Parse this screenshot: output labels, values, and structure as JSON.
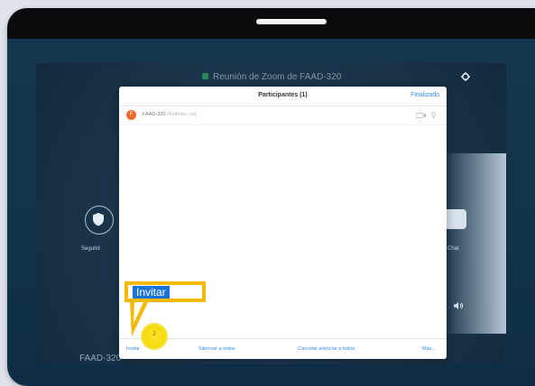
{
  "meeting": {
    "title": "Reunión de Zoom de FAAD-320",
    "room_name": "FAAD-320"
  },
  "side_controls": {
    "left_label": "Segurid",
    "right_label": "Chat"
  },
  "participants_panel": {
    "title": "Participantes (1)",
    "done_label": "Finalizado",
    "participants": [
      {
        "initial": "F",
        "name": "FAAD-320",
        "note": "(Anfitrión, yo)"
      }
    ],
    "footer": {
      "invite": "Invitar",
      "mute_all": "Silenciar a todos",
      "unmute_all": "Cancelar silenciar a todos",
      "more": "Más..."
    }
  },
  "callout": {
    "label": "Invitar",
    "step": "2"
  },
  "colors": {
    "accent_blue": "#2f8cf0",
    "callout_yellow": "#f5b900",
    "callout_label_bg": "#1a73d9",
    "avatar_orange": "#f06a2a"
  },
  "icons": [
    "gear-icon",
    "shield-icon",
    "chat-icon",
    "speaker-icon",
    "video-icon",
    "microphone-icon"
  ]
}
